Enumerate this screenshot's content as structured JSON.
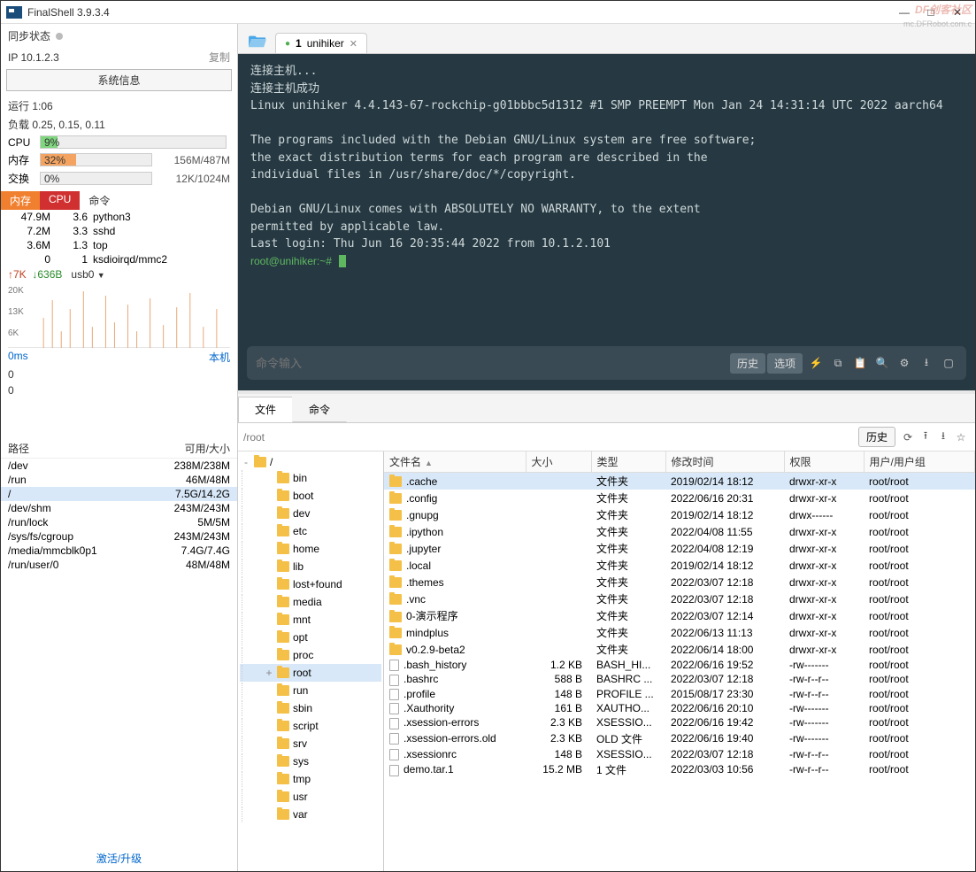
{
  "title": "FinalShell 3.9.3.4",
  "watermark": {
    "l1": "DF创客社区",
    "l2": "mc.DFRobot.com.c"
  },
  "win": {
    "min": "—",
    "max": "□",
    "close": "✕"
  },
  "left": {
    "sync": "同步状态",
    "ip_lbl": "IP 10.1.2.3",
    "copy": "复制",
    "sysinfo": "系统信息",
    "uptime": "运行 1:06",
    "load": "负载 0.25, 0.15, 0.11",
    "cpu_lbl": "CPU",
    "cpu_pct": "9%",
    "cpu_w": "9%",
    "mem_lbl": "内存",
    "mem_pct": "32%",
    "mem_val": "156M/487M",
    "mem_w": "32%",
    "swap_lbl": "交换",
    "swap_pct": "0%",
    "swap_val": "12K/1024M",
    "tabs": {
      "mem": "内存",
      "cpu": "CPU",
      "cmd": "命令"
    },
    "procs": [
      {
        "m": "47.9M",
        "c": "3.6",
        "n": "python3"
      },
      {
        "m": "7.2M",
        "c": "3.3",
        "n": "sshd"
      },
      {
        "m": "3.6M",
        "c": "1.3",
        "n": "top"
      },
      {
        "m": "0",
        "c": "1",
        "n": "ksdioirqd/mmc2"
      }
    ],
    "net": {
      "up": "7K",
      "dn": "636B",
      "if": "usb0",
      "y": [
        "20K",
        "13K",
        "6K"
      ]
    },
    "ping": {
      "ms": "0ms",
      "loc": "本机",
      "v0": "0",
      "v1": "0"
    },
    "paths_hdr": {
      "p": "路径",
      "s": "可用/大小"
    },
    "paths": [
      {
        "p": "/dev",
        "s": "238M/238M"
      },
      {
        "p": "/run",
        "s": "46M/48M"
      },
      {
        "p": "/",
        "s": "7.5G/14.2G",
        "hl": true
      },
      {
        "p": "/dev/shm",
        "s": "243M/243M"
      },
      {
        "p": "/run/lock",
        "s": "5M/5M"
      },
      {
        "p": "/sys/fs/cgroup",
        "s": "243M/243M"
      },
      {
        "p": "/media/mmcblk0p1",
        "s": "7.4G/7.4G"
      },
      {
        "p": "/run/user/0",
        "s": "48M/48M"
      }
    ],
    "foot": "激活/升级"
  },
  "tab": {
    "num": "1",
    "name": "unihiker"
  },
  "term_lines": [
    "连接主机...",
    "连接主机成功",
    "Linux unihiker 4.4.143-67-rockchip-g01bbbc5d1312 #1 SMP PREEMPT Mon Jan 24 14:31:14 UTC 2022 aarch64",
    "",
    "The programs included with the Debian GNU/Linux system are free software;",
    "the exact distribution terms for each program are described in the",
    "individual files in /usr/share/doc/*/copyright.",
    "",
    "Debian GNU/Linux comes with ABSOLUTELY NO WARRANTY, to the extent",
    "permitted by applicable law.",
    "Last login: Thu Jun 16 20:35:44 2022 from 10.1.2.101"
  ],
  "prompt": "root@unihiker:~#",
  "cmdbar": {
    "ph": "命令输入",
    "hist": "历史",
    "opt": "选项"
  },
  "fm": {
    "tab_file": "文件",
    "tab_cmd": "命令",
    "path": "/root",
    "hist": "历史"
  },
  "tree": [
    "bin",
    "boot",
    "dev",
    "etc",
    "home",
    "lib",
    "lost+found",
    "media",
    "mnt",
    "opt",
    "proc",
    "root",
    "run",
    "sbin",
    "script",
    "srv",
    "sys",
    "tmp",
    "usr",
    "var"
  ],
  "tree_sel": "root",
  "cols": {
    "name": "文件名",
    "size": "大小",
    "type": "类型",
    "mtime": "修改时间",
    "perm": "权限",
    "own": "用户/用户组"
  },
  "files": [
    {
      "n": ".cache",
      "sz": "",
      "t": "文件夹",
      "m": "2019/02/14 18:12",
      "p": "drwxr-xr-x",
      "o": "root/root",
      "d": true,
      "sel": true
    },
    {
      "n": ".config",
      "sz": "",
      "t": "文件夹",
      "m": "2022/06/16 20:31",
      "p": "drwxr-xr-x",
      "o": "root/root",
      "d": true
    },
    {
      "n": ".gnupg",
      "sz": "",
      "t": "文件夹",
      "m": "2019/02/14 18:12",
      "p": "drwx------",
      "o": "root/root",
      "d": true
    },
    {
      "n": ".ipython",
      "sz": "",
      "t": "文件夹",
      "m": "2022/04/08 11:55",
      "p": "drwxr-xr-x",
      "o": "root/root",
      "d": true
    },
    {
      "n": ".jupyter",
      "sz": "",
      "t": "文件夹",
      "m": "2022/04/08 12:19",
      "p": "drwxr-xr-x",
      "o": "root/root",
      "d": true
    },
    {
      "n": ".local",
      "sz": "",
      "t": "文件夹",
      "m": "2019/02/14 18:12",
      "p": "drwxr-xr-x",
      "o": "root/root",
      "d": true
    },
    {
      "n": ".themes",
      "sz": "",
      "t": "文件夹",
      "m": "2022/03/07 12:18",
      "p": "drwxr-xr-x",
      "o": "root/root",
      "d": true
    },
    {
      "n": ".vnc",
      "sz": "",
      "t": "文件夹",
      "m": "2022/03/07 12:18",
      "p": "drwxr-xr-x",
      "o": "root/root",
      "d": true
    },
    {
      "n": "0-演示程序",
      "sz": "",
      "t": "文件夹",
      "m": "2022/03/07 12:14",
      "p": "drwxr-xr-x",
      "o": "root/root",
      "d": true
    },
    {
      "n": "mindplus",
      "sz": "",
      "t": "文件夹",
      "m": "2022/06/13 11:13",
      "p": "drwxr-xr-x",
      "o": "root/root",
      "d": true
    },
    {
      "n": "v0.2.9-beta2",
      "sz": "",
      "t": "文件夹",
      "m": "2022/06/14 18:00",
      "p": "drwxr-xr-x",
      "o": "root/root",
      "d": true
    },
    {
      "n": ".bash_history",
      "sz": "1.2 KB",
      "t": "BASH_HI...",
      "m": "2022/06/16 19:52",
      "p": "-rw-------",
      "o": "root/root",
      "d": false
    },
    {
      "n": ".bashrc",
      "sz": "588 B",
      "t": "BASHRC ...",
      "m": "2022/03/07 12:18",
      "p": "-rw-r--r--",
      "o": "root/root",
      "d": false
    },
    {
      "n": ".profile",
      "sz": "148 B",
      "t": "PROFILE ...",
      "m": "2015/08/17 23:30",
      "p": "-rw-r--r--",
      "o": "root/root",
      "d": false
    },
    {
      "n": ".Xauthority",
      "sz": "161 B",
      "t": "XAUTHO...",
      "m": "2022/06/16 20:10",
      "p": "-rw-------",
      "o": "root/root",
      "d": false
    },
    {
      "n": ".xsession-errors",
      "sz": "2.3 KB",
      "t": "XSESSIO...",
      "m": "2022/06/16 19:42",
      "p": "-rw-------",
      "o": "root/root",
      "d": false
    },
    {
      "n": ".xsession-errors.old",
      "sz": "2.3 KB",
      "t": "OLD 文件",
      "m": "2022/06/16 19:40",
      "p": "-rw-------",
      "o": "root/root",
      "d": false
    },
    {
      "n": ".xsessionrc",
      "sz": "148 B",
      "t": "XSESSIO...",
      "m": "2022/03/07 12:18",
      "p": "-rw-r--r--",
      "o": "root/root",
      "d": false
    },
    {
      "n": "demo.tar.1",
      "sz": "15.2 MB",
      "t": "1 文件",
      "m": "2022/03/03 10:56",
      "p": "-rw-r--r--",
      "o": "root/root",
      "d": false
    }
  ]
}
